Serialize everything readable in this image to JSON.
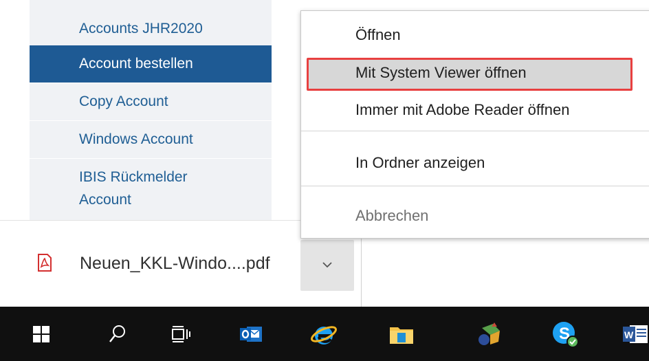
{
  "sidebar": {
    "items": [
      {
        "label": "Accounts JHR2020",
        "active": false
      },
      {
        "label": "Account bestellen",
        "active": true
      },
      {
        "label": "Copy Account",
        "active": false
      },
      {
        "label": "Windows Account",
        "active": false
      },
      {
        "label": "IBIS Rückmelder",
        "label2": "Account",
        "active": false
      }
    ]
  },
  "context_menu": {
    "items": [
      {
        "label": "Öffnen"
      },
      {
        "label": "Mit System Viewer öffnen",
        "hovered": true,
        "highlighted": true
      },
      {
        "label": "Immer mit Adobe Reader öffnen"
      },
      {
        "label": "In Ordner anzeigen"
      },
      {
        "label": "Abbrechen",
        "disabled": true
      }
    ]
  },
  "download_bar": {
    "file_name": "Neuen_KKL-Windo....pdf",
    "file_icon": "pdf-icon",
    "dropdown_icon": "chevron-down-icon"
  },
  "taskbar": {
    "icons": [
      "windows-start-icon",
      "search-icon",
      "task-view-icon",
      "outlook-icon",
      "internet-explorer-icon",
      "file-explorer-icon",
      "app-icon",
      "skype-icon",
      "word-icon"
    ]
  },
  "colors": {
    "sidebar_bg": "#f0f2f5",
    "sidebar_active": "#1e5a94",
    "sidebar_text": "#1f5e94",
    "highlight_border": "#e84040",
    "taskbar_bg": "#101010"
  }
}
